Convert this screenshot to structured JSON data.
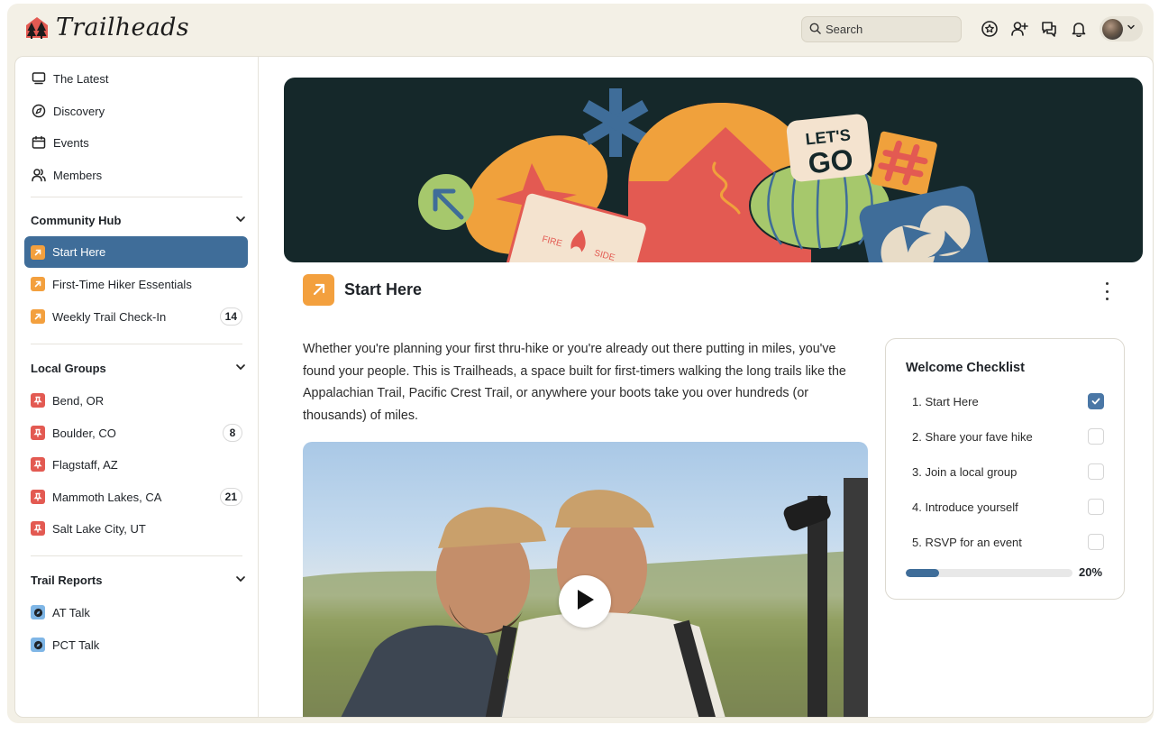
{
  "app": {
    "name": "Trailheads"
  },
  "header": {
    "search_placeholder": "Search",
    "icons": [
      "badge-star-icon",
      "add-user-icon",
      "chat-icon",
      "bell-icon"
    ]
  },
  "sidebar": {
    "main_nav": [
      {
        "label": "The Latest",
        "icon": "monitor-icon"
      },
      {
        "label": "Discovery",
        "icon": "compass-icon"
      },
      {
        "label": "Events",
        "icon": "calendar-icon"
      },
      {
        "label": "Members",
        "icon": "members-icon"
      }
    ],
    "sections": [
      {
        "title": "Community Hub",
        "items": [
          {
            "label": "Start Here",
            "active": true,
            "badge": ""
          },
          {
            "label": "First-Time Hiker Essentials",
            "badge": ""
          },
          {
            "label": "Weekly Trail Check-In",
            "badge": "14"
          }
        ]
      },
      {
        "title": "Local Groups",
        "items": [
          {
            "label": "Bend, OR",
            "badge": ""
          },
          {
            "label": "Boulder, CO",
            "badge": "8"
          },
          {
            "label": "Flagstaff, AZ",
            "badge": ""
          },
          {
            "label": "Mammoth Lakes, CA",
            "badge": "21"
          },
          {
            "label": "Salt Lake City, UT",
            "badge": ""
          }
        ]
      },
      {
        "title": "Trail Reports",
        "items": [
          {
            "label": "AT Talk",
            "badge": ""
          },
          {
            "label": "PCT Talk",
            "badge": ""
          }
        ]
      }
    ]
  },
  "hero": {
    "sticker_lets": "LET'S",
    "sticker_go": "GO",
    "sticker_fire": "FIRE",
    "sticker_side": "SIDE"
  },
  "page": {
    "title": "Start Here",
    "intro": "Whether you're planning your first thru-hike or you're already out there putting in miles, you've found your people. This is Trailheads, a space built for first-timers walking the long trails like the Appalachian Trail, Pacific Crest Trail, or anywhere your boots take you over hundreds (or thousands) of miles."
  },
  "checklist": {
    "title": "Welcome Checklist",
    "items": [
      {
        "label": "1. Start Here",
        "checked": true
      },
      {
        "label": "2. Share your fave hike",
        "checked": false
      },
      {
        "label": "3. Join a local group",
        "checked": false
      },
      {
        "label": "4. Introduce yourself",
        "checked": false
      },
      {
        "label": "5. RSVP for an event",
        "checked": false
      }
    ],
    "progress": 0.2,
    "progress_label": "20%"
  },
  "colors": {
    "accent_blue": "#3f6d99",
    "orange": "#f3a03e",
    "red": "#e35a52",
    "hero_bg": "#15282a"
  }
}
